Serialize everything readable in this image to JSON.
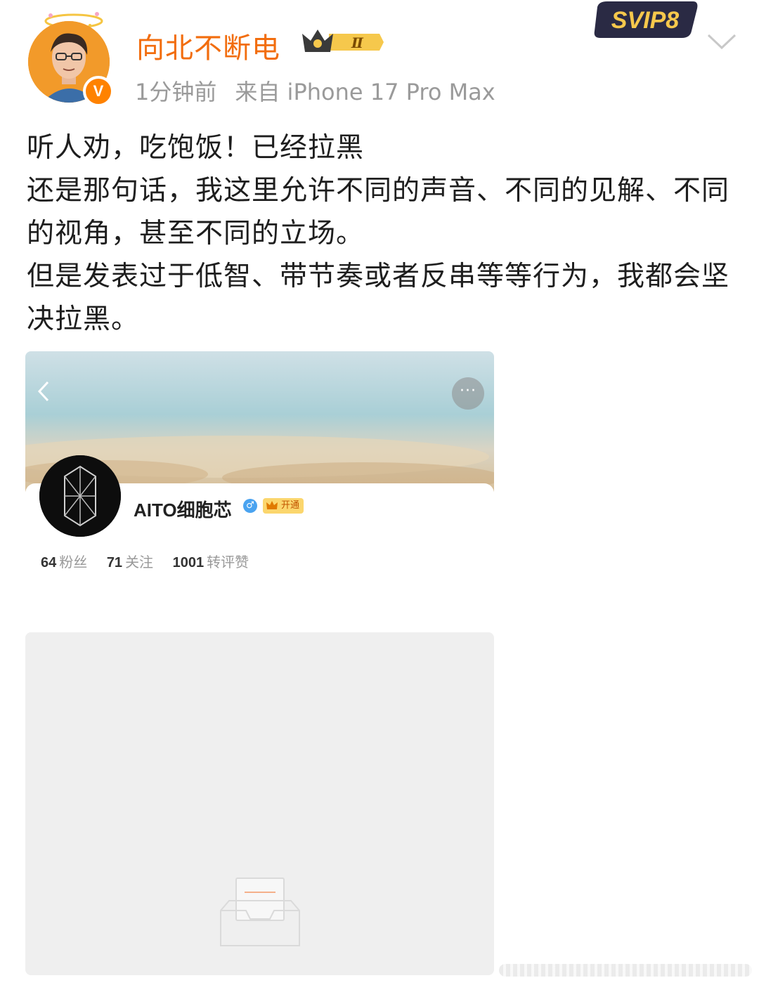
{
  "header": {
    "username": "向北不断电",
    "level_badge": "Ⅱ",
    "time": "1分钟前",
    "source": "来自 iPhone 17 Pro Max",
    "svip_label": "SVIP8",
    "verified_mark": "V"
  },
  "post": {
    "lines": [
      "听人劝，吃饱饭！已经拉黑",
      "还是那句话，我这里允许不同的声音、不同的见解、不同的视角，甚至不同的立场。",
      "但是发表过于低智、带节奏或者反串等等行为，我都会坚决拉黑。"
    ]
  },
  "embedded_profile": {
    "name": "AITO细胞芯",
    "gender_icon": "♂",
    "member_badge": "开通",
    "more_icon": "···",
    "back_icon": "back-chevron-icon",
    "stats": [
      {
        "value": "64",
        "label": "粉丝"
      },
      {
        "value": "71",
        "label": "关注"
      },
      {
        "value": "1001",
        "label": "转评赞"
      }
    ]
  },
  "colors": {
    "username": "#f26d0e",
    "meta": "#9a9a9a",
    "text": "#1e1e1e",
    "placeholder_bg": "#efefef"
  }
}
